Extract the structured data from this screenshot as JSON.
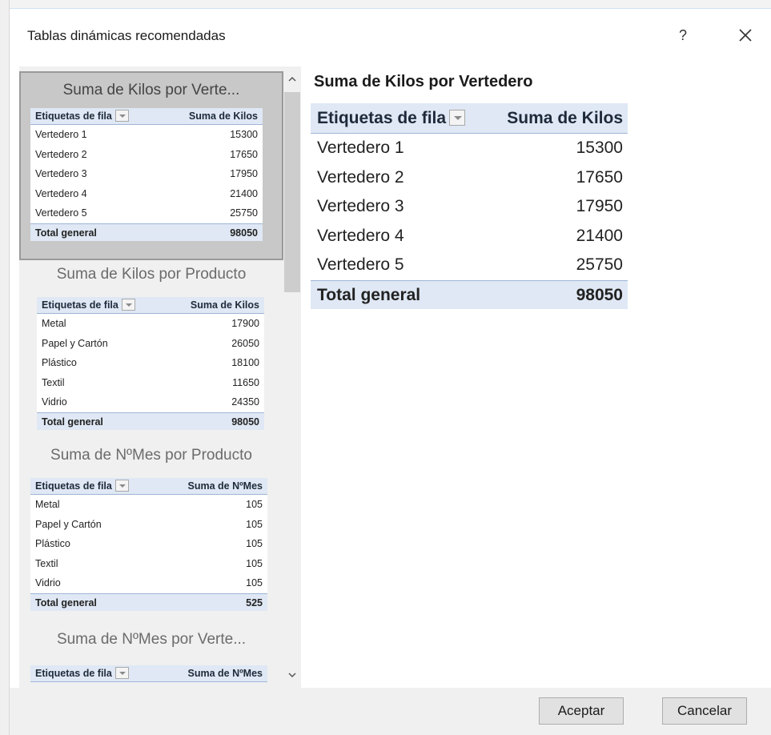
{
  "dialog": {
    "title": "Tablas dinámicas recomendadas",
    "help_label": "?",
    "close_label": "✕"
  },
  "recommendations": [
    {
      "title": "Suma de Kilos por Verte...",
      "header": [
        "Etiquetas de fila",
        "Suma de Kilos"
      ],
      "rows": [
        [
          "Vertedero 1",
          "15300"
        ],
        [
          "Vertedero 2",
          "17650"
        ],
        [
          "Vertedero 3",
          "17950"
        ],
        [
          "Vertedero 4",
          "21400"
        ],
        [
          "Vertedero 5",
          "25750"
        ]
      ],
      "total": [
        "Total general",
        "98050"
      ],
      "selected": true
    },
    {
      "title": "Suma de Kilos por Producto",
      "header": [
        "Etiquetas de fila",
        "Suma de Kilos"
      ],
      "rows": [
        [
          "Metal",
          "17900"
        ],
        [
          "Papel y Cartón",
          "26050"
        ],
        [
          "Plástico",
          "18100"
        ],
        [
          "Textil",
          "11650"
        ],
        [
          "Vidrio",
          "24350"
        ]
      ],
      "total": [
        "Total general",
        "98050"
      ],
      "selected": false
    },
    {
      "title": "Suma de NºMes por Producto",
      "header": [
        "Etiquetas de fila",
        "Suma de NºMes"
      ],
      "rows": [
        [
          "Metal",
          "105"
        ],
        [
          "Papel y Cartón",
          "105"
        ],
        [
          "Plástico",
          "105"
        ],
        [
          "Textil",
          "105"
        ],
        [
          "Vidrio",
          "105"
        ]
      ],
      "total": [
        "Total general",
        "525"
      ],
      "selected": false
    },
    {
      "title": "Suma de NºMes por Verte...",
      "header": [
        "Etiquetas de fila",
        "Suma de NºMes"
      ],
      "rows": [],
      "total": null,
      "selected": false
    }
  ],
  "preview": {
    "title": "Suma de Kilos por Vertedero",
    "header": [
      "Etiquetas de fila",
      "Suma de Kilos"
    ],
    "rows": [
      [
        "Vertedero 1",
        "15300"
      ],
      [
        "Vertedero 2",
        "17650"
      ],
      [
        "Vertedero 3",
        "17950"
      ],
      [
        "Vertedero 4",
        "21400"
      ],
      [
        "Vertedero 5",
        "25750"
      ]
    ],
    "total": [
      "Total general",
      "98050"
    ]
  },
  "buttons": {
    "ok_label": "Aceptar",
    "cancel_label": "Cancelar"
  },
  "icons": {
    "scroll_up": "chevron-up-icon",
    "scroll_down": "chevron-down-icon",
    "close": "close-icon",
    "filter_dropdown": "filter-dropdown-icon"
  },
  "colors": {
    "table_header_bg": "#dfe8f4",
    "table_border": "#9fb6d6",
    "selected_card_bg": "#c8c8c8"
  }
}
